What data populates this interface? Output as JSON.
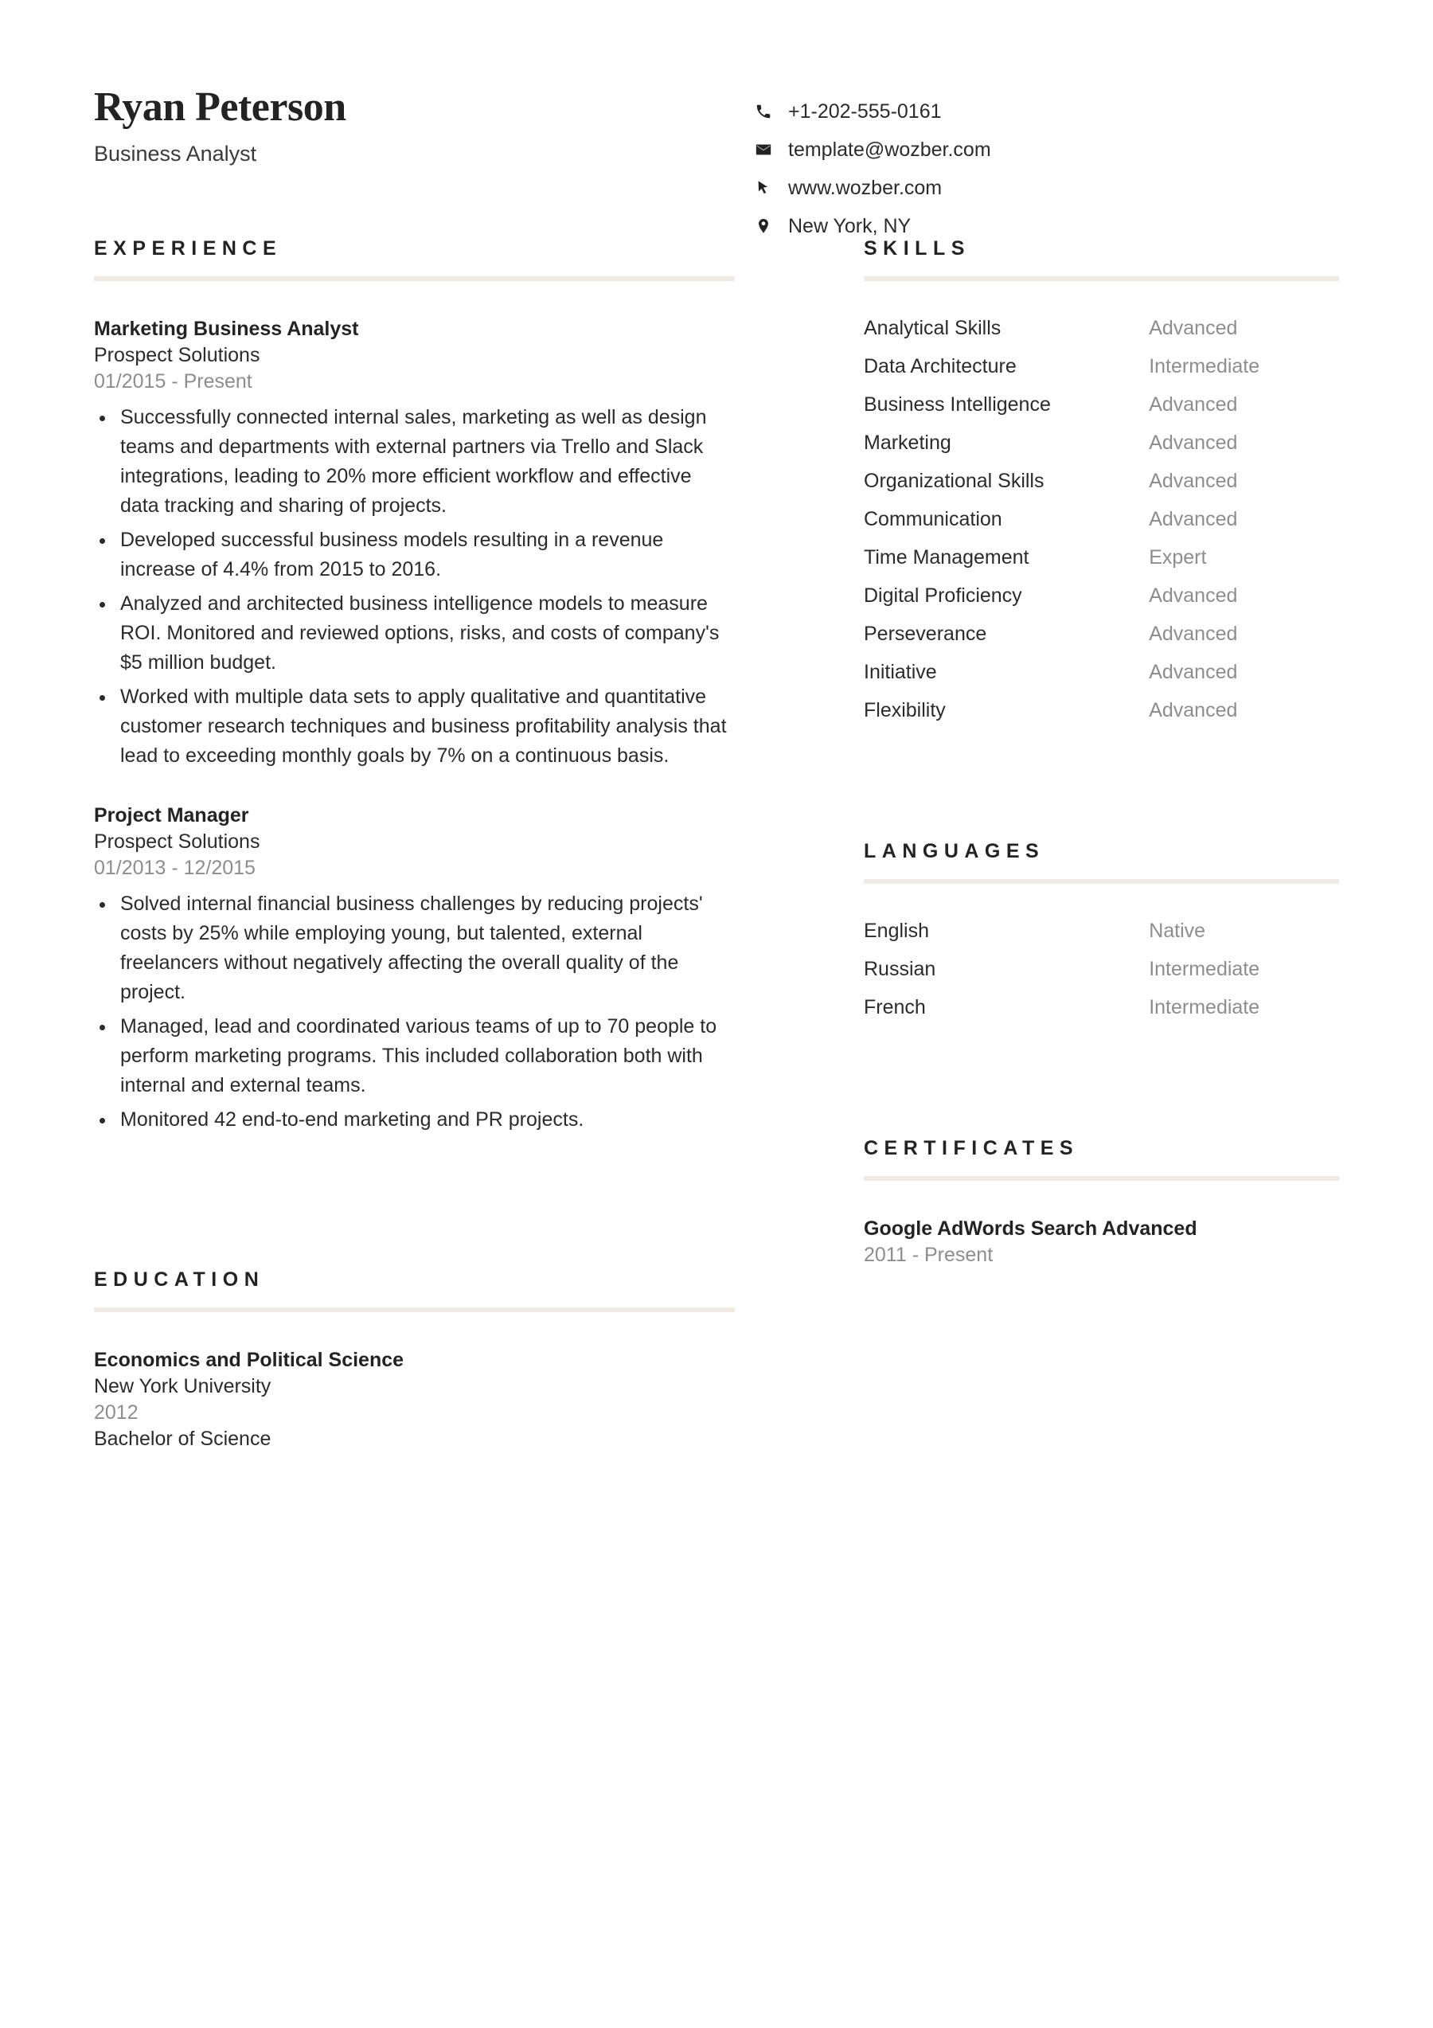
{
  "header": {
    "name": "Ryan Peterson",
    "job_title": "Business Analyst",
    "contacts": [
      {
        "icon": "phone-icon",
        "value": "+1-202-555-0161"
      },
      {
        "icon": "envelope-icon",
        "value": "template@wozber.com"
      },
      {
        "icon": "cursor-icon",
        "value": "www.wozber.com"
      },
      {
        "icon": "location-icon",
        "value": "New York, NY"
      }
    ]
  },
  "experience": {
    "title": "EXPERIENCE",
    "entries": [
      {
        "position": "Marketing Business Analyst",
        "company": "Prospect Solutions",
        "dates": "01/2015 - Present",
        "bullets": [
          "Successfully connected internal sales, marketing as well as design teams and departments with external partners via Trello and Slack integrations, leading to 20% more efficient workflow and effective data tracking and sharing of projects.",
          "Developed successful business models resulting in a revenue increase of 4.4% from 2015 to 2016.",
          "Analyzed and architected business intelligence models to measure ROI. Monitored and reviewed options, risks, and costs of company's $5 million budget.",
          "Worked with multiple data sets to apply qualitative and quantitative customer research techniques and business profitability analysis that lead to exceeding monthly goals by 7% on a continuous basis."
        ]
      },
      {
        "position": "Project Manager",
        "company": "Prospect Solutions",
        "dates": "01/2013 - 12/2015",
        "bullets": [
          "Solved internal financial business challenges by reducing projects' costs by 25% while employing young, but talented, external freelancers without negatively affecting the overall quality of the project.",
          "Managed, lead and coordinated various teams of up to 70 people to perform marketing programs. This included collaboration both with internal and external teams.",
          "Monitored 42 end-to-end marketing and PR projects."
        ]
      }
    ]
  },
  "education": {
    "title": "EDUCATION",
    "entries": [
      {
        "program": "Economics and Political Science",
        "school": "New York University",
        "year": "2012",
        "degree": "Bachelor of Science"
      }
    ]
  },
  "skills": {
    "title": "SKILLS",
    "items": [
      {
        "name": "Analytical Skills",
        "level": "Advanced"
      },
      {
        "name": "Data Architecture",
        "level": "Intermediate"
      },
      {
        "name": "Business Intelligence",
        "level": "Advanced"
      },
      {
        "name": "Marketing",
        "level": "Advanced"
      },
      {
        "name": "Organizational Skills",
        "level": "Advanced"
      },
      {
        "name": "Communication",
        "level": "Advanced"
      },
      {
        "name": "Time Management",
        "level": "Expert"
      },
      {
        "name": "Digital Proficiency",
        "level": "Advanced"
      },
      {
        "name": "Perseverance",
        "level": "Advanced"
      },
      {
        "name": "Initiative",
        "level": "Advanced"
      },
      {
        "name": "Flexibility",
        "level": "Advanced"
      }
    ]
  },
  "languages": {
    "title": "LANGUAGES",
    "items": [
      {
        "name": "English",
        "level": "Native"
      },
      {
        "name": "Russian",
        "level": "Intermediate"
      },
      {
        "name": "French",
        "level": "Intermediate"
      }
    ]
  },
  "certificates": {
    "title": "CERTIFICATES",
    "entries": [
      {
        "name": "Google AdWords Search Advanced",
        "dates": "2011 - Present"
      }
    ]
  },
  "colors": {
    "rule": "#efebe3",
    "text": "#2b2b2b",
    "muted": "#8d8d8d",
    "heading": "#232323"
  }
}
